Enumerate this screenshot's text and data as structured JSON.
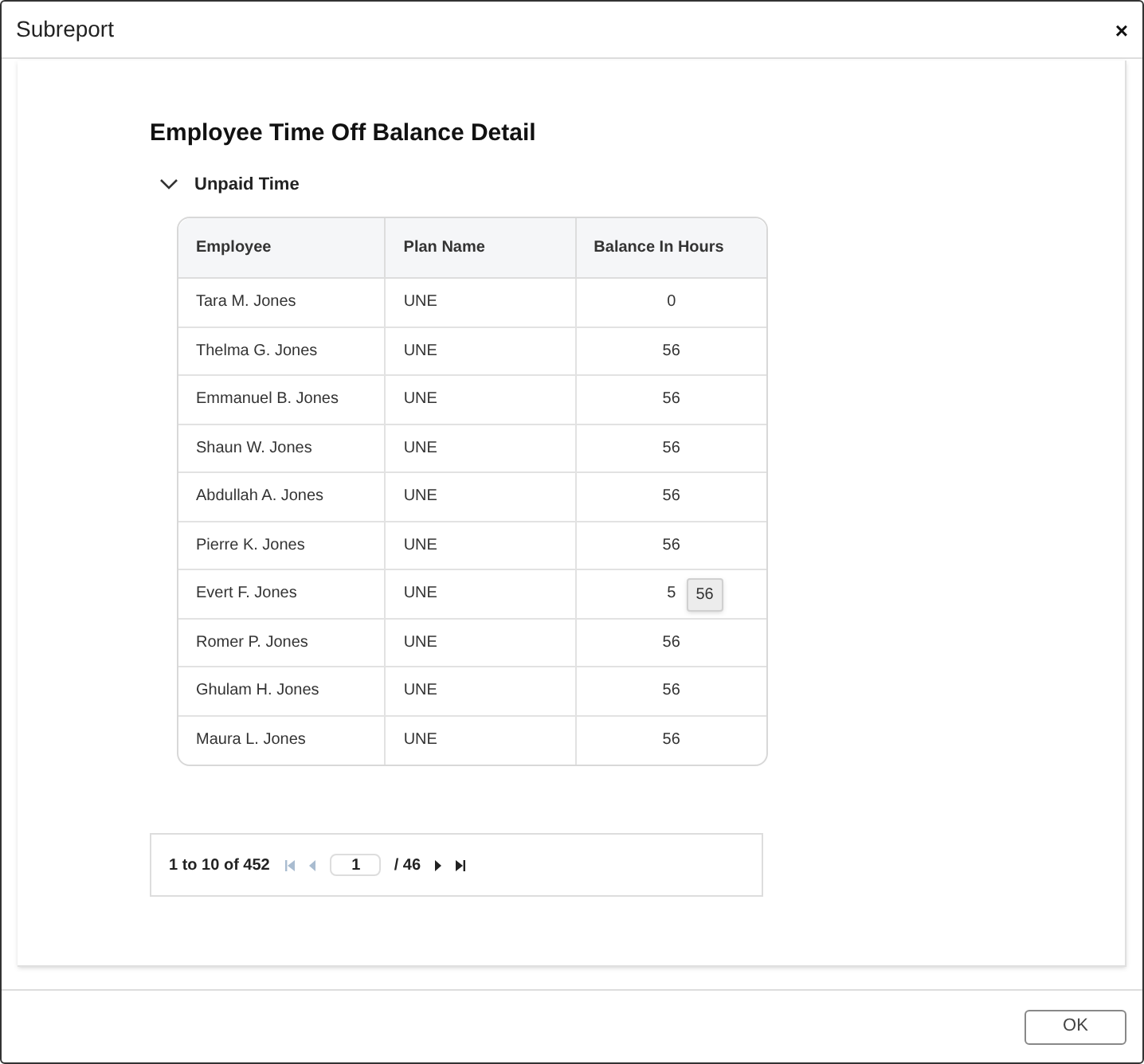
{
  "window": {
    "title": "Subreport",
    "close": "×"
  },
  "report": {
    "title": "Employee Time Off Balance Detail",
    "group": {
      "label": "Unpaid Time",
      "expanded": true
    },
    "table": {
      "columns": [
        "Employee",
        "Plan Name",
        "Balance In Hours"
      ],
      "rows": [
        {
          "employee": "Tara M. Jones",
          "plan": "UNE",
          "balance": "0"
        },
        {
          "employee": "Thelma G. Jones",
          "plan": "UNE",
          "balance": "56"
        },
        {
          "employee": "Emmanuel B. Jones",
          "plan": "UNE",
          "balance": "56"
        },
        {
          "employee": "Shaun W. Jones",
          "plan": "UNE",
          "balance": "56"
        },
        {
          "employee": "Abdullah A. Jones",
          "plan": "UNE",
          "balance": "56"
        },
        {
          "employee": "Pierre K. Jones",
          "plan": "UNE",
          "balance": "56"
        },
        {
          "employee": "Evert F. Jones",
          "plan": "UNE",
          "balance": "5",
          "tooltip": "56"
        },
        {
          "employee": "Romer P. Jones",
          "plan": "UNE",
          "balance": "56"
        },
        {
          "employee": "Ghulam H. Jones",
          "plan": "UNE",
          "balance": "56"
        },
        {
          "employee": "Maura L. Jones",
          "plan": "UNE",
          "balance": "56"
        }
      ]
    },
    "pagination": {
      "summary": "1 to 10 of 452",
      "page": "1",
      "total": "/ 46",
      "buttons": [
        {
          "kind": "first",
          "disabled": true
        },
        {
          "kind": "prev",
          "disabled": true
        },
        {
          "kind": "next",
          "disabled": false
        },
        {
          "kind": "last",
          "disabled": false
        }
      ]
    }
  },
  "buttons": [
    "OK"
  ]
}
